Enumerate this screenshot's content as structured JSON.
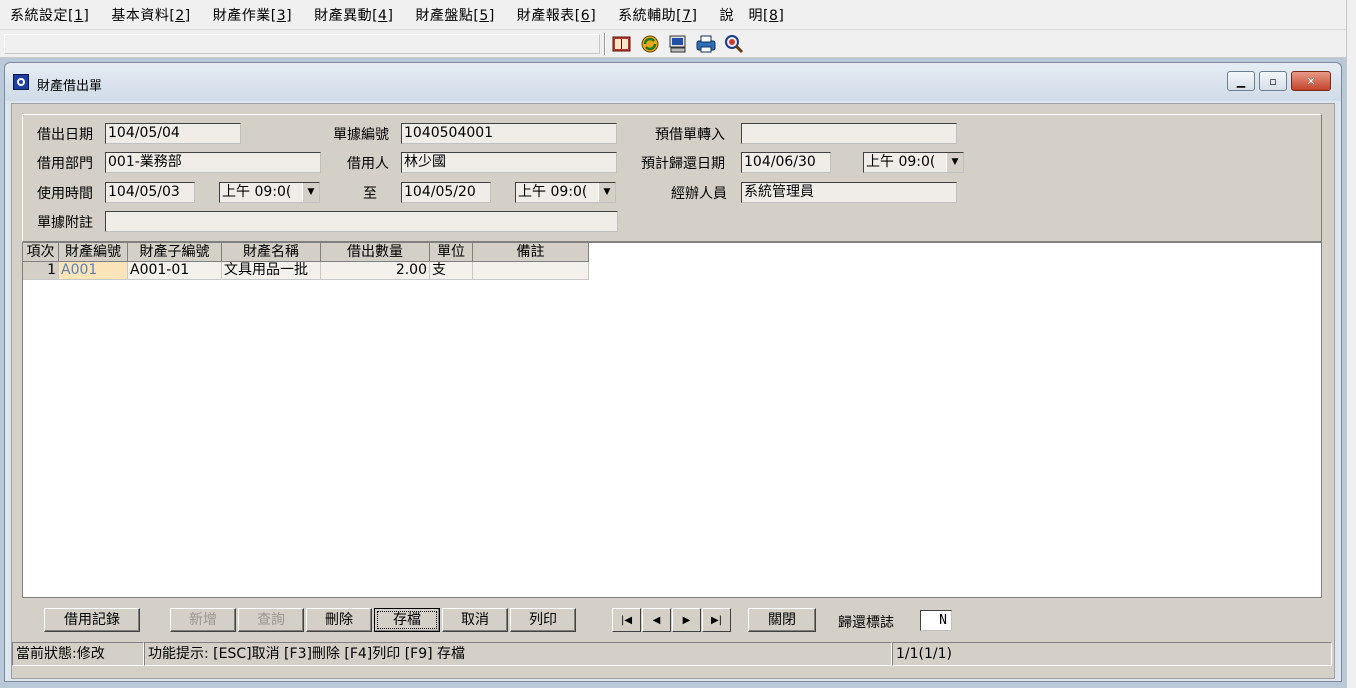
{
  "menu": [
    {
      "label": "系統設定[",
      "key": "1",
      "end": "]"
    },
    {
      "label": "基本資料[",
      "key": "2",
      "end": "]"
    },
    {
      "label": "財產作業[",
      "key": "3",
      "end": "]"
    },
    {
      "label": "財產異動[",
      "key": "4",
      "end": "]"
    },
    {
      "label": "財產盤點[",
      "key": "5",
      "end": "]"
    },
    {
      "label": "財產報表[",
      "key": "6",
      "end": "]"
    },
    {
      "label": "系統輔助[",
      "key": "7",
      "end": "]"
    },
    {
      "label": "說　明[",
      "key": "8",
      "end": "]"
    }
  ],
  "toolbar_icons": [
    "book-icon",
    "refresh-icon",
    "computer-icon",
    "printer-icon",
    "search-icon"
  ],
  "window": {
    "title": "財產借出單",
    "controls": {
      "minimize": "▁",
      "restore": "▫",
      "close": "✕"
    }
  },
  "form": {
    "loan_date_label": "借出日期",
    "loan_date": "104/05/04",
    "doc_no_label": "單據編號",
    "doc_no": "1040504001",
    "pre_loan_label": "預借單轉入",
    "pre_loan": "",
    "dept_label": "借用部門",
    "dept": "001-業務部",
    "borrower_label": "借用人",
    "borrower": "林少國",
    "return_date_label": "預計歸還日期",
    "return_date": "104/06/30",
    "return_time": "上午 09:0(",
    "use_time_label": "使用時間",
    "use_start_date": "104/05/03",
    "use_start_time": "上午 09:0(",
    "to_label": "至",
    "use_end_date": "104/05/20",
    "use_end_time": "上午 09:0(",
    "handler_label": "經辦人員",
    "handler": "系統管理員",
    "note_label": "單據附註",
    "note": ""
  },
  "grid": {
    "columns": [
      "項次",
      "財產編號",
      "財產子編號",
      "財產名稱",
      "借出數量",
      "單位",
      "備註"
    ],
    "rows": [
      [
        "1",
        "A001",
        "A001-01",
        "文具用品一批",
        "2.00",
        "支",
        ""
      ]
    ]
  },
  "buttons": {
    "history": "借用記錄",
    "add": "新增",
    "query": "查詢",
    "delete": "刪除",
    "save": "存檔",
    "cancel": "取消",
    "print": "列印",
    "close": "關閉"
  },
  "nav": {
    "first": "|◀",
    "prev": "◀",
    "next": "▶",
    "last": "▶|"
  },
  "return_flag_label": "歸還標誌",
  "return_flag": "N",
  "status": {
    "state": "當前狀態:修改",
    "hint": "功能提示: [ESC]取消 [F3]刪除 [F4]列印 [F9] 存檔",
    "record": "1/1(1/1)"
  },
  "colors": {
    "selected_cell_bg": "#fbe4b8",
    "selected_cell_text": "#5a7fb5",
    "close_button": "#c4432b"
  }
}
